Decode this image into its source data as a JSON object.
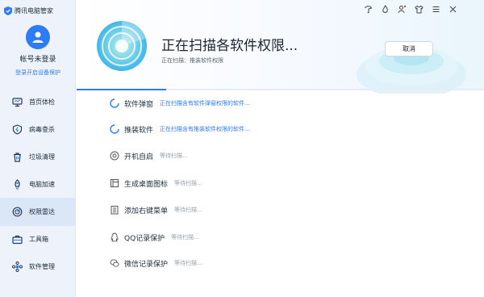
{
  "app": {
    "name": "腾讯电脑管家"
  },
  "user": {
    "account": "帐号未登录",
    "login_link": "登录开启设备保护"
  },
  "sidebar": {
    "items": [
      {
        "label": "首页体检",
        "icon": "monitor-icon"
      },
      {
        "label": "病毒查杀",
        "icon": "shield-bolt-icon"
      },
      {
        "label": "垃圾清理",
        "icon": "trash-icon"
      },
      {
        "label": "电脑加速",
        "icon": "rocket-icon"
      },
      {
        "label": "权限雷达",
        "icon": "radar-icon",
        "active": true
      },
      {
        "label": "工具箱",
        "icon": "toolbox-icon"
      },
      {
        "label": "软件管理",
        "icon": "apps-icon"
      }
    ]
  },
  "header": {
    "title": "正在扫描各软件权限...",
    "subtitle": "正在扫描：推装软件权限",
    "cancel_label": "取消",
    "progress": 0.22
  },
  "window_controls": [
    "skin-icon",
    "flame-icon",
    "user-settings-icon",
    "shirt-icon",
    "menu-icon",
    "close-icon"
  ],
  "tasks": [
    {
      "name": "软件弹窗",
      "status": "正在扫描含有软件弹窗权限的软件...",
      "state": "scanning",
      "icon": "spinner-icon"
    },
    {
      "name": "推装软件",
      "status": "正在扫描含有推装软件权限的软件...",
      "state": "scanning",
      "icon": "spinner-icon"
    },
    {
      "name": "开机自启",
      "status": "等待扫描...",
      "state": "waiting",
      "icon": "power-icon"
    },
    {
      "name": "生成桌面图标",
      "status": "等待扫描...",
      "state": "waiting",
      "icon": "desktop-icon"
    },
    {
      "name": "添加右键菜单",
      "status": "等待扫描...",
      "state": "waiting",
      "icon": "context-menu-icon"
    },
    {
      "name": "QQ记录保护",
      "status": "等待扫描...",
      "state": "waiting",
      "icon": "qq-icon"
    },
    {
      "name": "微信记录保护",
      "status": "等待扫描...",
      "state": "waiting",
      "icon": "wechat-icon"
    }
  ],
  "colors": {
    "accent": "#2d7cf6",
    "sidebar_bg": "#eef3fb",
    "active_bg": "#dbe6f7",
    "muted": "#9aa3ad"
  }
}
